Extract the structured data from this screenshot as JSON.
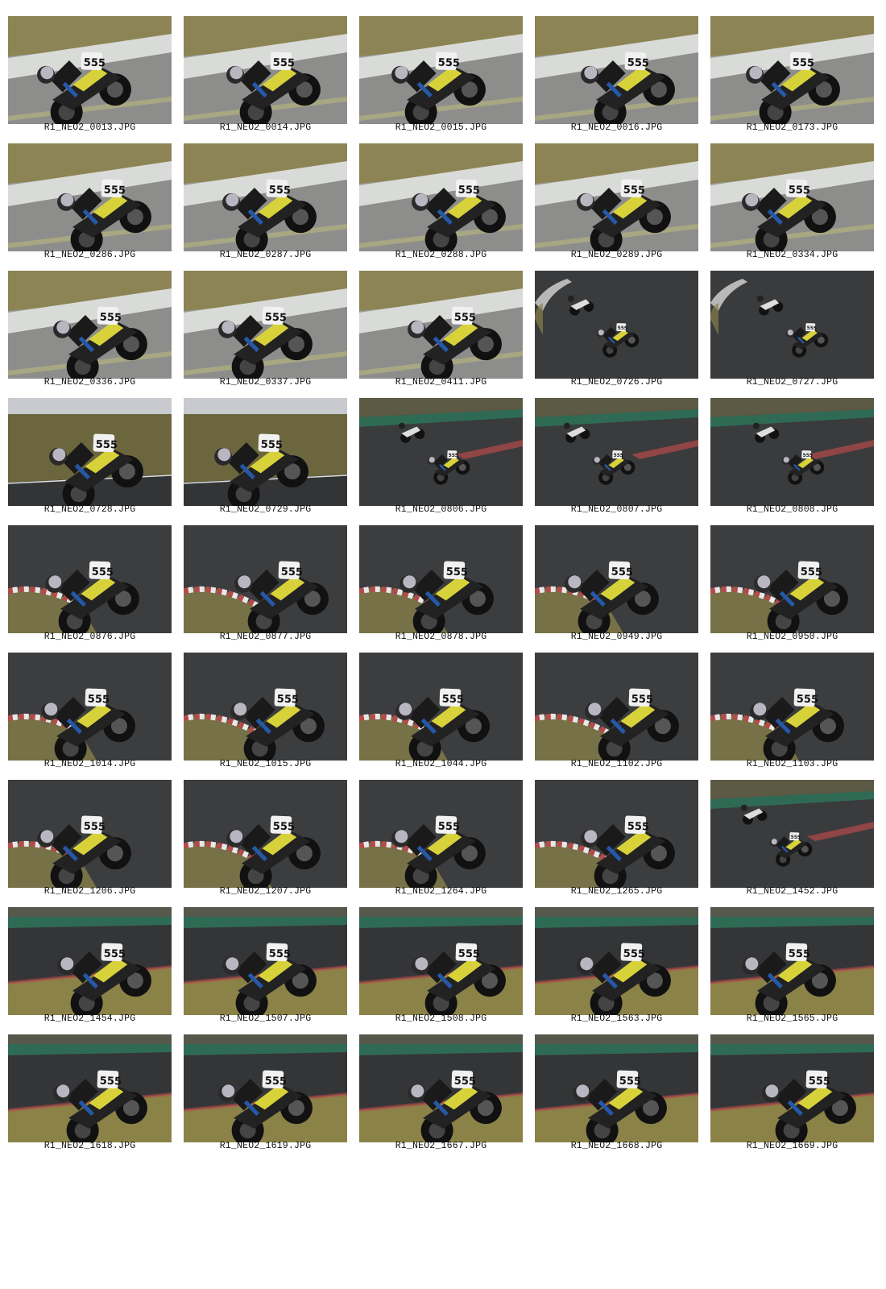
{
  "photos": [
    {
      "filename": "R1_NEO2_0013.JPG",
      "scene": "day"
    },
    {
      "filename": "R1_NEO2_0014.JPG",
      "scene": "day"
    },
    {
      "filename": "R1_NEO2_0015.JPG",
      "scene": "day"
    },
    {
      "filename": "R1_NEO2_0016.JPG",
      "scene": "day"
    },
    {
      "filename": "R1_NEO2_0173.JPG",
      "scene": "day"
    },
    {
      "filename": "R1_NEO2_0286.JPG",
      "scene": "day"
    },
    {
      "filename": "R1_NEO2_0287.JPG",
      "scene": "day"
    },
    {
      "filename": "R1_NEO2_0288.JPG",
      "scene": "day"
    },
    {
      "filename": "R1_NEO2_0289.JPG",
      "scene": "day"
    },
    {
      "filename": "R1_NEO2_0334.JPG",
      "scene": "day"
    },
    {
      "filename": "R1_NEO2_0336.JPG",
      "scene": "day"
    },
    {
      "filename": "R1_NEO2_0337.JPG",
      "scene": "day"
    },
    {
      "filename": "R1_NEO2_0411.JPG",
      "scene": "day"
    },
    {
      "filename": "R1_NEO2_0726.JPG",
      "scene": "dark-track"
    },
    {
      "filename": "R1_NEO2_0727.JPG",
      "scene": "dark-track"
    },
    {
      "filename": "R1_NEO2_0728.JPG",
      "scene": "grass-shadow"
    },
    {
      "filename": "R1_NEO2_0729.JPG",
      "scene": "grass-shadow"
    },
    {
      "filename": "R1_NEO2_0806.JPG",
      "scene": "dark-track-green"
    },
    {
      "filename": "R1_NEO2_0807.JPG",
      "scene": "dark-track-green"
    },
    {
      "filename": "R1_NEO2_0808.JPG",
      "scene": "dark-track-green"
    },
    {
      "filename": "R1_NEO2_0876.JPG",
      "scene": "curb-corner"
    },
    {
      "filename": "R1_NEO2_0877.JPG",
      "scene": "curb-corner"
    },
    {
      "filename": "R1_NEO2_0878.JPG",
      "scene": "curb-corner"
    },
    {
      "filename": "R1_NEO2_0949.JPG",
      "scene": "curb-corner"
    },
    {
      "filename": "R1_NEO2_0950.JPG",
      "scene": "curb-corner"
    },
    {
      "filename": "R1_NEO2_1014.JPG",
      "scene": "curb-corner"
    },
    {
      "filename": "R1_NEO2_1015.JPG",
      "scene": "curb-corner"
    },
    {
      "filename": "R1_NEO2_1044.JPG",
      "scene": "curb-corner"
    },
    {
      "filename": "R1_NEO2_1102.JPG",
      "scene": "curb-corner"
    },
    {
      "filename": "R1_NEO2_1103.JPG",
      "scene": "curb-corner"
    },
    {
      "filename": "R1_NEO2_1206.JPG",
      "scene": "curb-corner"
    },
    {
      "filename": "R1_NEO2_1207.JPG",
      "scene": "curb-corner"
    },
    {
      "filename": "R1_NEO2_1264.JPG",
      "scene": "curb-corner"
    },
    {
      "filename": "R1_NEO2_1265.JPG",
      "scene": "curb-corner"
    },
    {
      "filename": "R1_NEO2_1452.JPG",
      "scene": "dark-track-green"
    },
    {
      "filename": "R1_NEO2_1454.JPG",
      "scene": "straight-green"
    },
    {
      "filename": "R1_NEO2_1507.JPG",
      "scene": "straight-green"
    },
    {
      "filename": "R1_NEO2_1508.JPG",
      "scene": "straight-green"
    },
    {
      "filename": "R1_NEO2_1563.JPG",
      "scene": "straight-green"
    },
    {
      "filename": "R1_NEO2_1565.JPG",
      "scene": "straight-green"
    },
    {
      "filename": "R1_NEO2_1618.JPG",
      "scene": "straight-green"
    },
    {
      "filename": "R1_NEO2_1619.JPG",
      "scene": "straight-green"
    },
    {
      "filename": "R1_NEO2_1667.JPG",
      "scene": "straight-green"
    },
    {
      "filename": "R1_NEO2_1668.JPG",
      "scene": "straight-green"
    },
    {
      "filename": "R1_NEO2_1669.JPG",
      "scene": "straight-green"
    }
  ],
  "colors": {
    "page_background": "#ffffff",
    "caption_text": "#111111",
    "track_asphalt_day": "#8d8e8c",
    "track_asphalt_dark": "#3a3b3d",
    "grass": "#8a7e4a",
    "green_wall": "#2f6a55",
    "curb_red": "#b54a4a",
    "bike_white": "#f1f1f1",
    "bike_yellow": "#d8d23a"
  }
}
